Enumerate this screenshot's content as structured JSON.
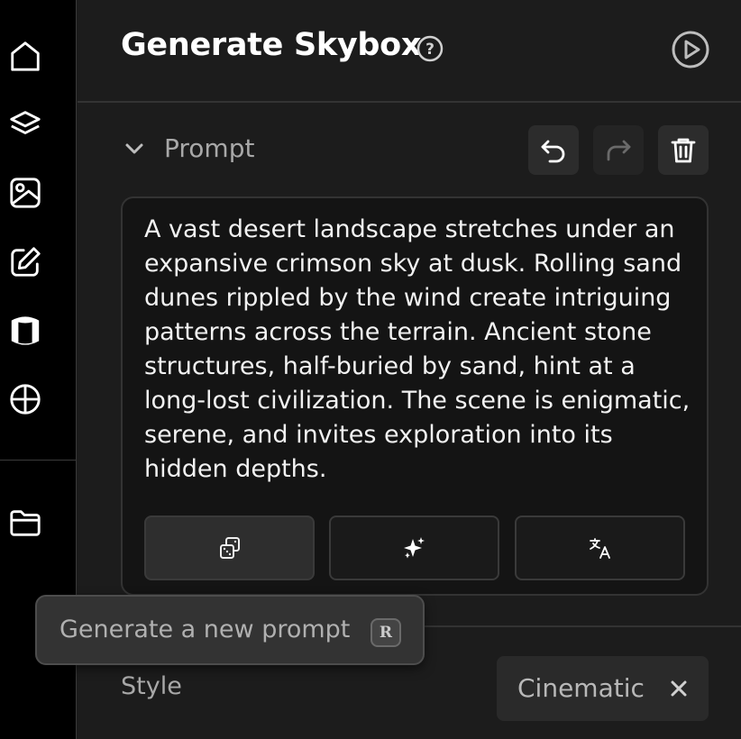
{
  "sidebar": {
    "items": [
      {
        "icon": "home-icon"
      },
      {
        "icon": "layers-icon"
      },
      {
        "icon": "image-icon"
      },
      {
        "icon": "edit-icon"
      },
      {
        "icon": "cylinder-icon"
      },
      {
        "icon": "globe-icon"
      },
      {
        "icon": "folder-icon"
      }
    ]
  },
  "header": {
    "title": "Generate Skybox",
    "help_icon": "question-circle-icon",
    "play_icon": "play-circle-icon"
  },
  "prompt_section": {
    "label": "Prompt",
    "toolbar": {
      "undo_icon": "undo-icon",
      "redo_icon": "redo-icon",
      "delete_icon": "trash-icon"
    },
    "text": "A vast desert landscape stretches under an expansive crimson sky at dusk. Rolling sand dunes rippled by the wind create intriguing patterns across the terrain. Ancient stone structures, half-buried by sand, hint at a long-lost civilization. The scene is enigmatic, serene, and invites exploration into its hidden depths.",
    "actions": [
      {
        "icon": "dice-icon"
      },
      {
        "icon": "sparkles-icon"
      },
      {
        "icon": "translate-icon"
      }
    ]
  },
  "tooltip": {
    "text": "Generate a new prompt",
    "shortcut": "R"
  },
  "style_section": {
    "label": "Style",
    "selected": "Cinematic"
  },
  "colors": {
    "background": "#1c1c1c",
    "sidebar": "#000000",
    "text": "#f2f2f2",
    "muted": "#a8a8a8"
  }
}
